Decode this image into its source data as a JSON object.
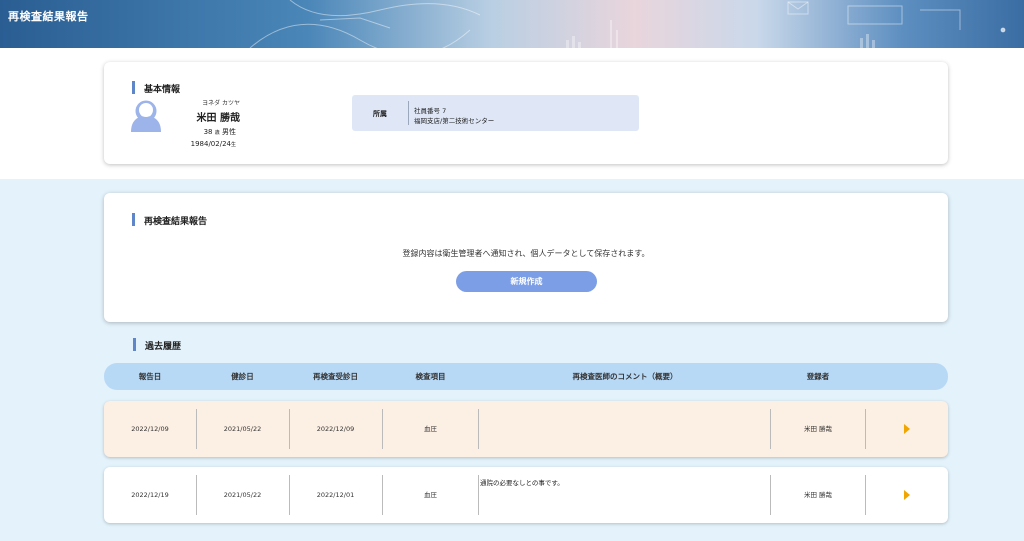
{
  "header": {
    "title": "再検査結果報告"
  },
  "basic_info": {
    "section_title": "基本情報",
    "name_kana": "ヨネダ カツヤ",
    "name": "米田 勝哉",
    "age": "38",
    "age_unit": "歳",
    "gender": "男性",
    "birthdate": "1984/02/24",
    "birth_unit": "生",
    "affiliation": {
      "label": "所属",
      "employee_no": "社員番号  7",
      "department": "福岡支店/第二技術センター"
    }
  },
  "report": {
    "section_title": "再検査結果報告",
    "notice": "登録内容は衛生管理者へ通知され、個人データとして保存されます。",
    "new_button": "新規作成"
  },
  "history": {
    "section_title": "過去履歴",
    "columns": [
      "報告日",
      "健診日",
      "再検査受診日",
      "検査項目",
      "再検査医師のコメント（概要）",
      "登録者"
    ],
    "rows": [
      {
        "report_date": "2022/12/09",
        "checkup_date": "2021/05/22",
        "recheck_date": "2022/12/09",
        "item": "血圧",
        "comment": "",
        "registrant": "米田 勝哉"
      },
      {
        "report_date": "2022/12/19",
        "checkup_date": "2021/05/22",
        "recheck_date": "2022/12/01",
        "item": "血圧",
        "comment": "通院の必要なしとの事です。",
        "registrant": "米田 勝哉"
      }
    ]
  },
  "colors": {
    "accent": "#5f86c9",
    "button": "#7b9ee6",
    "table_head": "#b7d9f6",
    "row_highlight": "#fcefe3",
    "arrow": "#f0a500"
  },
  "icons": {
    "avatar": "user-avatar-icon",
    "row_action": "play-arrow-icon"
  }
}
